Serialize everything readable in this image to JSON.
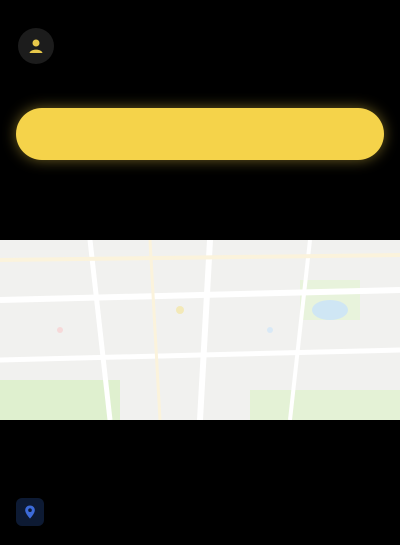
{
  "header": {
    "title": "",
    "subtitle": "",
    "avatar_icon": "person-icon"
  },
  "primary_action": {
    "label": ""
  },
  "map_section": {
    "heading": ""
  },
  "list": {
    "label": "",
    "items": [
      {
        "icon": "location-pin-icon",
        "label": ""
      }
    ]
  },
  "colors": {
    "background": "#000000",
    "accent": "#f5d34a",
    "map_background": "#f1f1ef"
  }
}
